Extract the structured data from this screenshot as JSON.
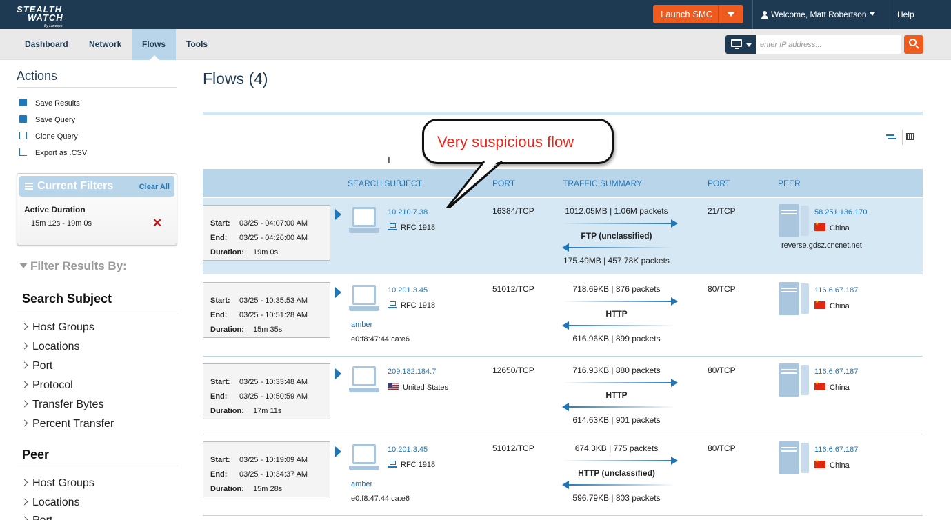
{
  "header": {
    "logo_line1": "STEALTH",
    "logo_line2": "WATCH",
    "logo_sub": "By Lancope",
    "launch_label": "Launch SMC",
    "welcome": "Welcome, Matt Robertson",
    "help": "Help"
  },
  "nav": {
    "tabs": [
      "Dashboard",
      "Network",
      "Flows",
      "Tools"
    ],
    "active": "Flows"
  },
  "search": {
    "placeholder": "enter IP address..."
  },
  "actions": {
    "title": "Actions",
    "items": [
      "Save Results",
      "Save Query",
      "Clone Query",
      "Export as .CSV"
    ]
  },
  "current_filters": {
    "title": "Current Filters",
    "clear": "Clear All",
    "filter_name": "Active Duration",
    "filter_value": "15m 12s - 19m 0s"
  },
  "filter_results": {
    "title": "Filter Results By:",
    "search_subject_title": "Search Subject",
    "search_subject_items": [
      "Host Groups",
      "Locations",
      "Port",
      "Protocol",
      "Transfer Bytes",
      "Percent Transfer"
    ],
    "peer_title": "Peer",
    "peer_items": [
      "Host Groups",
      "Locations",
      "Port"
    ]
  },
  "main": {
    "title": "Flows (4)",
    "callout": "Very suspicious flow",
    "columns": [
      "SEARCH SUBJECT",
      "PORT",
      "TRAFFIC SUMMARY",
      "PORT",
      "PEER"
    ],
    "time_labels": {
      "start": "Start:",
      "end": "End:",
      "duration": "Duration:"
    },
    "rows": [
      {
        "start": "03/25 - 04:07:00 AM",
        "end": "03/25 - 04:26:00 AM",
        "duration": "19m 0s",
        "subject_ip": "10.210.7.38",
        "subject_loc": "RFC 1918",
        "subject_host": "",
        "subject_mac": "",
        "port": "16384/TCP",
        "sent": "1012.05MB | 1.06M packets",
        "protocol": "FTP (unclassified)",
        "recv": "175.49MB | 457.78K packets",
        "peer_port": "21/TCP",
        "peer_ip": "58.251.136.170",
        "peer_country": "China",
        "peer_dns": "reverse.gdsz.cncnet.net"
      },
      {
        "start": "03/25 - 10:35:53 AM",
        "end": "03/25 - 10:51:28 AM",
        "duration": "15m 35s",
        "subject_ip": "10.201.3.45",
        "subject_loc": "RFC 1918",
        "subject_host": "amber",
        "subject_mac": "e0:f8:47:44:ca:e6",
        "port": "51012/TCP",
        "sent": "718.69KB | 876 packets",
        "protocol": "HTTP",
        "recv": "616.96KB | 899 packets",
        "peer_port": "80/TCP",
        "peer_ip": "116.6.67.187",
        "peer_country": "China",
        "peer_dns": ""
      },
      {
        "start": "03/25 - 10:33:48 AM",
        "end": "03/25 - 10:50:59 AM",
        "duration": "17m 11s",
        "subject_ip": "209.182.184.7",
        "subject_loc": "United States",
        "subject_host": "",
        "subject_mac": "",
        "port": "12650/TCP",
        "sent": "716.93KB | 880 packets",
        "protocol": "HTTP",
        "recv": "614.63KB | 901 packets",
        "peer_port": "80/TCP",
        "peer_ip": "116.6.67.187",
        "peer_country": "China",
        "peer_dns": ""
      },
      {
        "start": "03/25 - 10:19:09 AM",
        "end": "03/25 - 10:34:37 AM",
        "duration": "15m 28s",
        "subject_ip": "10.201.3.45",
        "subject_loc": "RFC 1918",
        "subject_host": "amber",
        "subject_mac": "e0:f8:47:44:ca:e6",
        "port": "51012/TCP",
        "sent": "674.3KB | 775 packets",
        "protocol": "HTTP (unclassified)",
        "recv": "596.79KB | 803 packets",
        "peer_port": "80/TCP",
        "peer_ip": "116.6.67.187",
        "peer_country": "China",
        "peer_dns": ""
      }
    ]
  },
  "colors": {
    "topbar": "#1e3a52",
    "accent": "#ef5a1e",
    "link": "#2176b8",
    "highlight": "#d6e8f4"
  },
  "icons": [
    "user-icon",
    "monitor-icon",
    "search-icon",
    "save-icon",
    "clone-icon",
    "export-icon",
    "list-icon",
    "funnel-icon",
    "laptop-icon",
    "server-icon",
    "network-icon",
    "flag-cn-icon",
    "flag-us-icon"
  ]
}
